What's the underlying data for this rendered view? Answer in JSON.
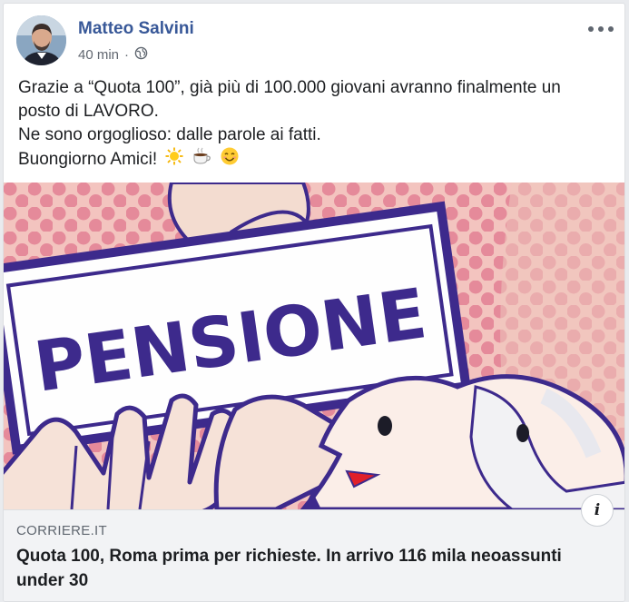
{
  "post": {
    "author": "Matteo Salvini",
    "time": "40 min",
    "separator": "·",
    "audience_icon": "globe-icon",
    "text_lines": [
      "Grazie a “Quota 100”, già più di 100.000 giovani avranno finalmente un",
      "posto di LAVORO.",
      "Ne sono orgoglioso: dalle parole ai fatti.",
      "Buongiorno Amici!"
    ],
    "emojis": [
      "sun-emoji",
      "coffee-emoji",
      "smiling-face-emoji"
    ]
  },
  "link": {
    "image_word": "PENSIONE",
    "domain": "CORRIERE.IT",
    "headline": "Quota 100, Roma prima per richieste. In arrivo 116 mila neoassunti under 30",
    "info_label": "i"
  },
  "colors": {
    "author": "#385898",
    "image_bg": "#f3c4bf",
    "sign_outline": "#3d2a8c",
    "dots": "#e58a9a"
  }
}
